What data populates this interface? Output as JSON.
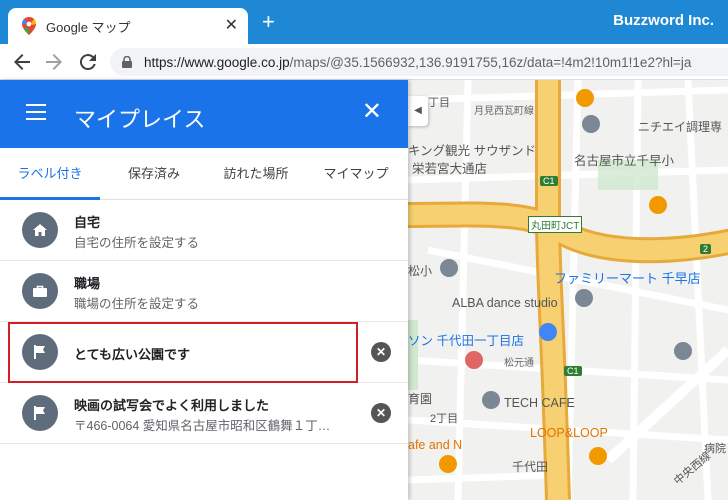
{
  "browser": {
    "tab_title": "Google マップ",
    "tab_close": "✕",
    "new_tab": "+",
    "window_label": "Buzzword Inc.",
    "url_main": "https://www.google.co.jp",
    "url_rest": "/maps/@35.1566932,136.9191755,16z/data=!4m2!10m1!1e2?hl=ja"
  },
  "panel": {
    "title": "マイプレイス",
    "close": "✕",
    "tabs": [
      {
        "label": "ラベル付き"
      },
      {
        "label": "保存済み"
      },
      {
        "label": "訪れた場所"
      },
      {
        "label": "マイマップ"
      }
    ],
    "items": [
      {
        "name": "自宅",
        "sub": "自宅の住所を設定する"
      },
      {
        "name": "職場",
        "sub": "職場の住所を設定する"
      },
      {
        "name": "とても広い公園です",
        "sub": ""
      },
      {
        "name": "映画の試写会でよく利用しました",
        "sub": "〒466-0064 愛知県名古屋市昭和区鶴舞１丁…"
      }
    ],
    "delete_glyph": "✕"
  },
  "map": {
    "labels": {
      "l1": "丁目",
      "l2": "月見西瓦町線",
      "l3": "ニチエイ調理専",
      "l4": "キング観光 サウザンド",
      "l5": "栄若宮大通店",
      "l6": "名古屋市立千早小",
      "l7": "丸田町JCT",
      "l8": "松小",
      "l9": "ファミリーマート 千早店",
      "l10": "ALBA dance studio",
      "l11": "ソン 千代田一丁目店",
      "l12": "松元通",
      "l13": "育園",
      "l14": "2丁目",
      "l15": "TECH CAFE",
      "l16": "afe and N",
      "l17": "LOOP&LOOP",
      "l18": "千代田",
      "l19": "中央西線",
      "l20": "病院",
      "s1": "C1",
      "s2": "C1",
      "s3": "2",
      "s4": "C1"
    }
  },
  "colors": {
    "accent": "#1a73e8",
    "browser_bar": "#1e88d4",
    "highlight": "#d21f26",
    "highway": "#f2c14e"
  }
}
